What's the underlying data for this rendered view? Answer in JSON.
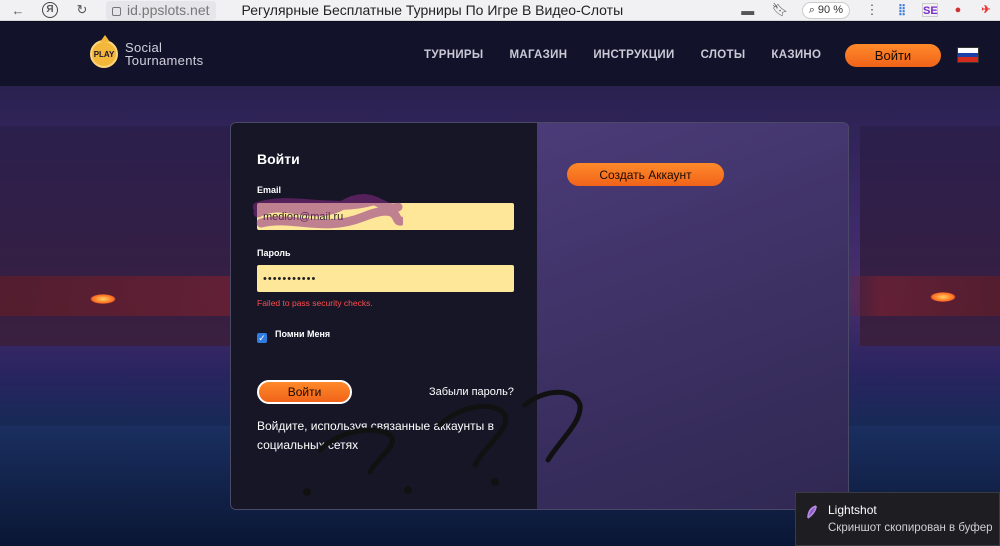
{
  "browser": {
    "url": "id.ppslots.net",
    "tab_title": "Регулярные Бесплатные Турниры По Игре В Видео-Слоты",
    "zoom": "90 %",
    "yandex_label": "Я",
    "ext_label": "SE"
  },
  "header": {
    "logo_badge": "PLAY",
    "logo_line1": "Social",
    "logo_line2": "Tournaments",
    "nav": [
      "ТУРНИРЫ",
      "МАГАЗИН",
      "ИНСТРУКЦИИ",
      "СЛОТЫ",
      "КАЗИНО"
    ],
    "login_button": "Войти",
    "flag_colors": [
      "#ffffff",
      "#1c3fa8",
      "#d52b1e"
    ]
  },
  "login_form": {
    "title": "Войти",
    "email_label": "Email",
    "email_value": "medion@mail.ru",
    "password_label": "Пароль",
    "password_value": "•••••••••••",
    "error": "Failed to pass security checks.",
    "remember_label": "Помни Меня",
    "remember_checked": true,
    "submit_button": "Войти",
    "forgot_link": "Забыли пароль?",
    "social_text": "Войдите, используя связанные аккаунты в социальных сетях"
  },
  "register": {
    "create_button": "Создать Аккаунт"
  },
  "notification": {
    "title": "Lightshot",
    "message": "Скриншот скопирован в буфер"
  },
  "colors": {
    "accent": "#f0631a",
    "input_bg": "#ffe79a",
    "error": "#ff4d4d",
    "card_left": "#161627",
    "card_right": "#4b3b78"
  }
}
